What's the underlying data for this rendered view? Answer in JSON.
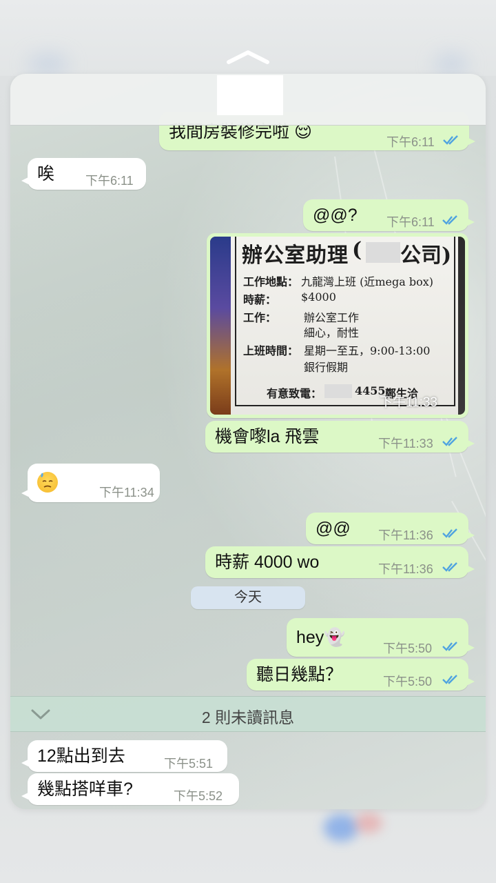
{
  "colors": {
    "outgoing_bubble": "#dcf8c6",
    "incoming_bubble": "#ffffff",
    "read_ticks": "#4fa3e0",
    "date_pill": "#d8e4f0",
    "unread_bar": "#c8ded2"
  },
  "messages": [
    {
      "dir": "out",
      "text": "我間房裝修完啦 😌",
      "time": "下午6:11"
    },
    {
      "dir": "in",
      "text": "唉",
      "time": "下午6:11"
    },
    {
      "dir": "out",
      "text": "@@?",
      "time": "下午6:11"
    },
    {
      "dir": "out",
      "type": "photo",
      "time": "下午11:33"
    },
    {
      "dir": "out",
      "text": "機會嚟la 飛雲",
      "time": "下午11:33"
    },
    {
      "dir": "in",
      "type": "emoji",
      "emoji": "downcast-sweat-face",
      "time": "下午11:34"
    },
    {
      "dir": "out",
      "text": "@@",
      "time": "下午11:36"
    },
    {
      "dir": "out",
      "text": "時薪 4000 wo",
      "time": "下午11:36"
    },
    {
      "dir": "out",
      "text": "hey👻",
      "time": "下午5:50"
    },
    {
      "dir": "out",
      "text": "聽日幾點？",
      "time": "下午5:50"
    },
    {
      "dir": "in",
      "text": "12點出到去",
      "time": "下午5:51"
    },
    {
      "dir": "in",
      "text": "幾點搭咩車?",
      "time": "下午5:52"
    }
  ],
  "photo": {
    "title": "辦公室助理",
    "title_paren": "(",
    "title_company": "公司)",
    "location_label": "工作地點：",
    "location_value": "九龍灣上班 (近mega box)",
    "wage_label": "時薪：",
    "wage_value": "$4000",
    "work_label": "工作：",
    "work_value_1": "辦公室工作",
    "work_value_2": "細心，耐性",
    "hours_label": "上班時間：",
    "hours_value_1": "星期一至五，9:00-13:00",
    "hours_value_2": "銀行假期",
    "contact_label": "有意致電：",
    "contact_number": "4455",
    "contact_person": "鄭生洽"
  },
  "date_separator": "今天",
  "unread_banner": "2 則未讀訊息"
}
